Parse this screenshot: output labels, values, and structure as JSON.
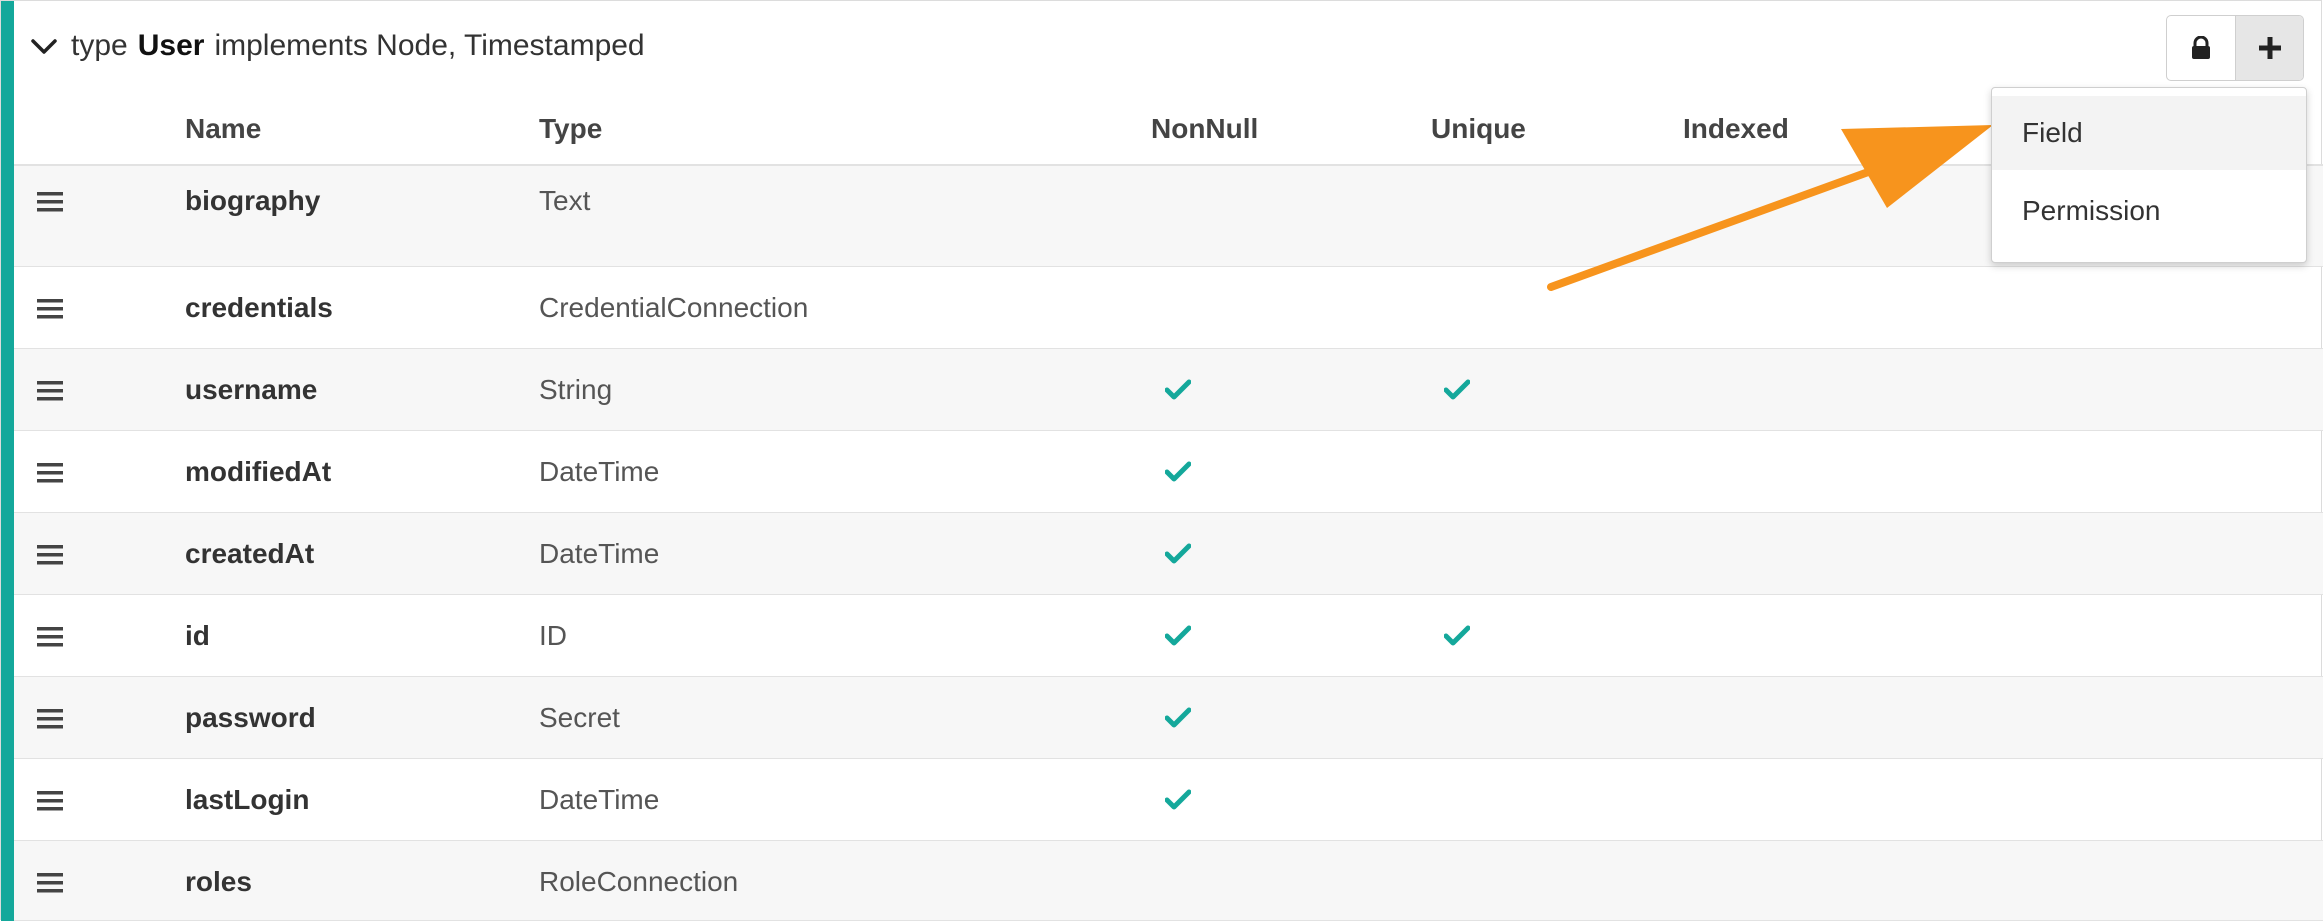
{
  "colors": {
    "accent": "#14a89b",
    "check": "#14a89b",
    "arrow": "#f7941d"
  },
  "header": {
    "keyword": "type",
    "type_name": "User",
    "implements_text": "implements Node, Timestamped"
  },
  "toolbar": {
    "lock_icon": "lock-icon",
    "add_icon": "plus-icon"
  },
  "columns": {
    "name": "Name",
    "type": "Type",
    "nonnull": "NonNull",
    "unique": "Unique",
    "indexed": "Indexed"
  },
  "rows": [
    {
      "name": "biography",
      "type": "Text",
      "nonnull": false,
      "unique": false,
      "indexed": false
    },
    {
      "name": "credentials",
      "type": "CredentialConnection",
      "nonnull": false,
      "unique": false,
      "indexed": false
    },
    {
      "name": "username",
      "type": "String",
      "nonnull": true,
      "unique": true,
      "indexed": false
    },
    {
      "name": "modifiedAt",
      "type": "DateTime",
      "nonnull": true,
      "unique": false,
      "indexed": false
    },
    {
      "name": "createdAt",
      "type": "DateTime",
      "nonnull": true,
      "unique": false,
      "indexed": false
    },
    {
      "name": "id",
      "type": "ID",
      "nonnull": true,
      "unique": true,
      "indexed": false
    },
    {
      "name": "password",
      "type": "Secret",
      "nonnull": true,
      "unique": false,
      "indexed": false
    },
    {
      "name": "lastLogin",
      "type": "DateTime",
      "nonnull": true,
      "unique": false,
      "indexed": false
    },
    {
      "name": "roles",
      "type": "RoleConnection",
      "nonnull": false,
      "unique": false,
      "indexed": false
    }
  ],
  "dropdown": {
    "items": [
      {
        "label": "Field"
      },
      {
        "label": "Permission"
      }
    ]
  }
}
